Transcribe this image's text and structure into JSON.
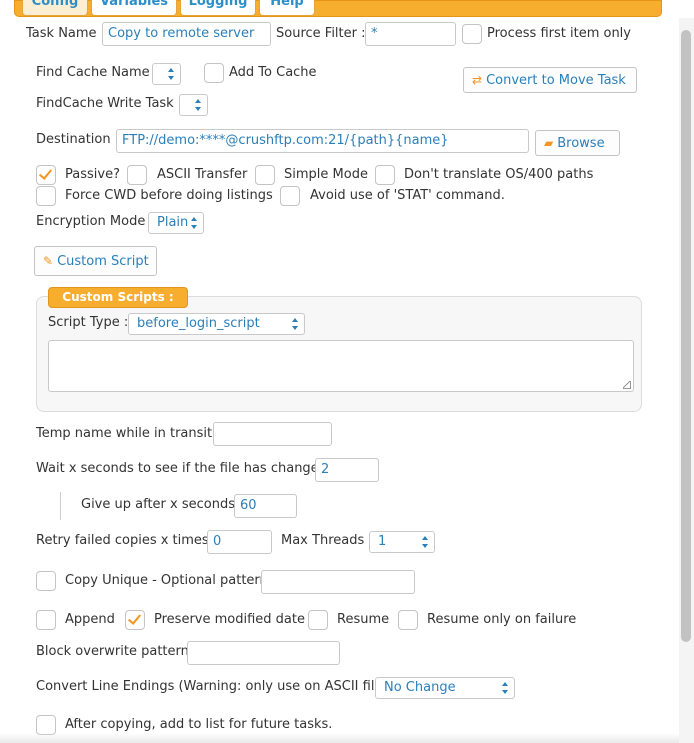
{
  "tabs": [
    {
      "label": "Config",
      "active": true
    },
    {
      "label": "Variables",
      "active": false
    },
    {
      "label": "Logging",
      "active": false
    },
    {
      "label": "Help",
      "active": false
    }
  ],
  "task_name": {
    "label": "Task Name :",
    "value": "Copy to remote server"
  },
  "source_filter": {
    "label": "Source Filter :",
    "value": "*"
  },
  "process_first": {
    "label": "Process first item only",
    "checked": false
  },
  "find_cache": {
    "label": "Find Cache Name :",
    "value": ""
  },
  "add_to_cache": {
    "label": "Add To Cache",
    "checked": false
  },
  "convert_button": {
    "label": "Convert to Move Task",
    "icon": "swap-arrows-icon"
  },
  "findcache_write": {
    "label": "FindCache Write Task :",
    "value": ""
  },
  "destination": {
    "label": "Destination :",
    "value": "FTP://demo:****@crushftp.com:21/{path}{name}"
  },
  "browse_button": {
    "label": "Browse",
    "icon": "folder-icon"
  },
  "options_row1": [
    {
      "label": "Passive?",
      "checked": true
    },
    {
      "label": "ASCII Transfer",
      "checked": false
    },
    {
      "label": "Simple Mode",
      "checked": false
    },
    {
      "label": "Don't translate OS/400 paths",
      "checked": false
    }
  ],
  "options_row2": [
    {
      "label": "Force CWD before doing listings",
      "checked": false
    },
    {
      "label": "Avoid use of 'STAT' command.",
      "checked": false
    }
  ],
  "encryption": {
    "label": "Encryption Mode :",
    "value": "Plain"
  },
  "custom_script_button": {
    "label": "Custom Script",
    "icon": "script-icon"
  },
  "custom_scripts": {
    "title": "Custom Scripts :",
    "script_type_label": "Script Type :",
    "script_type_value": "before_login_script",
    "script_text": ""
  },
  "temp_name": {
    "label": "Temp name while in transit :",
    "value": ""
  },
  "wait_seconds": {
    "label": "Wait x seconds to see if the file has changed :",
    "value": "2"
  },
  "give_up": {
    "label": "Give up after x seconds :",
    "value": "60"
  },
  "retry": {
    "label": "Retry failed copies x times :",
    "value": "0"
  },
  "max_threads": {
    "label": "Max Threads :",
    "value": "1"
  },
  "copy_unique": {
    "label": "Copy Unique - Optional pattern:",
    "checked": false,
    "value": ""
  },
  "options_row3": [
    {
      "label": "Append",
      "checked": false
    },
    {
      "label": "Preserve modified date",
      "checked": true
    },
    {
      "label": "Resume",
      "checked": false
    },
    {
      "label": "Resume only on failure",
      "checked": false
    }
  ],
  "block_overwrite": {
    "label": "Block overwrite pattern:",
    "value": ""
  },
  "line_endings": {
    "label": "Convert Line Endings (Warning: only use on ASCII files) :",
    "value": "No Change"
  },
  "after_copying": {
    "label": "After copying, add to list for future tasks.",
    "checked": false
  },
  "colors": {
    "accent": "#f7ad2e",
    "link": "#2b7fb9",
    "check": "#f29521"
  }
}
